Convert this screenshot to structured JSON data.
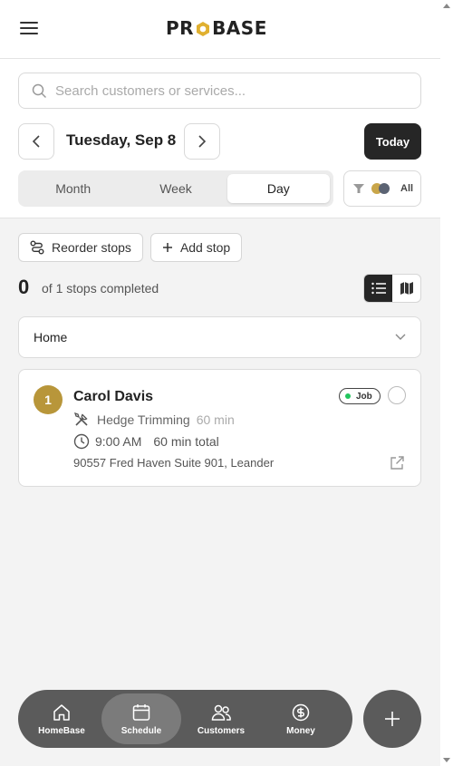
{
  "brand": {
    "logo_left": "PR",
    "logo_right": "BASE",
    "accent": "#e0b030"
  },
  "search": {
    "placeholder": "Search customers or services..."
  },
  "date_nav": {
    "date_label": "Tuesday, Sep 8",
    "today_label": "Today"
  },
  "views": {
    "tabs": [
      "Month",
      "Week",
      "Day"
    ],
    "active": "Day"
  },
  "filter": {
    "label": "All"
  },
  "actions": {
    "reorder_label": "Reorder stops",
    "add_label": "Add stop"
  },
  "progress": {
    "completed": "0",
    "label": "of 1 stops completed"
  },
  "group": {
    "label": "Home"
  },
  "stops": [
    {
      "number": "1",
      "customer": "Carol Davis",
      "badge": "Job",
      "service": "Hedge Trimming",
      "service_duration": "60 min",
      "time": "9:00 AM",
      "total": "60 min total",
      "address": "90557 Fred Haven Suite 901, Leander"
    }
  ],
  "bottom_nav": {
    "items": [
      "HomeBase",
      "Schedule",
      "Customers",
      "Money"
    ],
    "active": "Schedule"
  },
  "colors": {
    "dark": "#262626",
    "stop_badge": "#b8963a",
    "status_dot": "#22c55e",
    "nav_bg": "#5b5b5b"
  }
}
